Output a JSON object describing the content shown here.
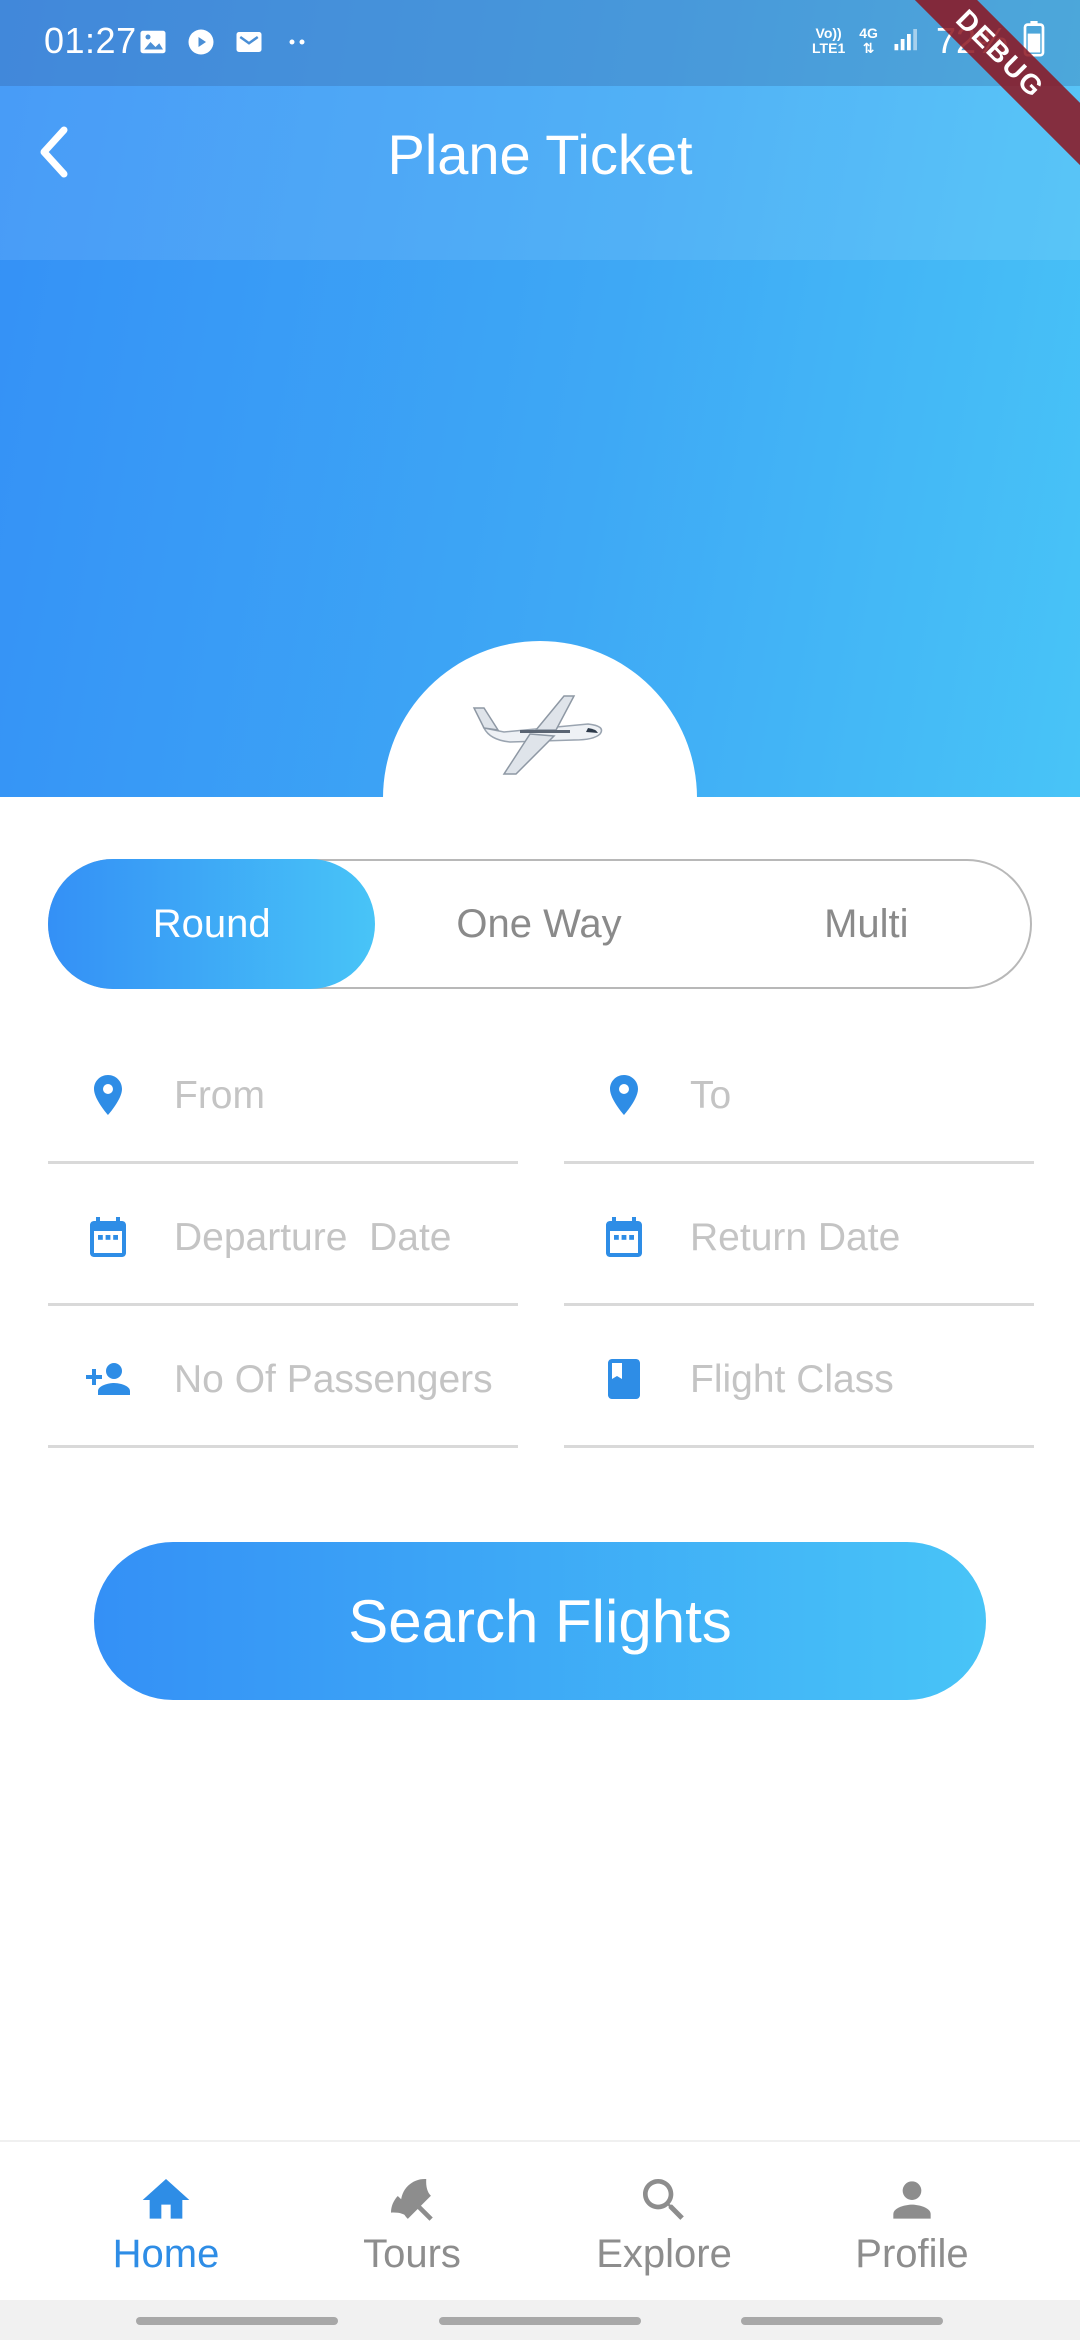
{
  "status_bar": {
    "time": "01:27",
    "network_top": "Vo))",
    "network_bottom": "LTE1",
    "net_type_top": "4G",
    "battery": "72%",
    "debug_label": "DEBUG",
    "icons": [
      "gallery-icon",
      "play-icon",
      "mail-icon",
      "more-dots-icon",
      "signal-icon",
      "battery-icon"
    ]
  },
  "header": {
    "title": "Plane Ticket",
    "back_icon": "chevron-left-icon"
  },
  "trip_types": [
    {
      "label": "Round",
      "active": true
    },
    {
      "label": "One Way",
      "active": false
    },
    {
      "label": "Multi",
      "active": false
    }
  ],
  "fields": {
    "from": {
      "placeholder": "From",
      "icon": "location-pin-icon"
    },
    "to": {
      "placeholder": "To",
      "icon": "location-pin-icon"
    },
    "departure": {
      "placeholder": "Departure  Date",
      "icon": "calendar-icon"
    },
    "return": {
      "placeholder": "Return Date",
      "icon": "calendar-icon"
    },
    "passengers": {
      "placeholder": "No Of Passengers",
      "icon": "add-person-icon"
    },
    "flight_class": {
      "placeholder": "Flight Class",
      "icon": "book-icon"
    }
  },
  "search_button": {
    "label": "Search Flights"
  },
  "bottom_nav": [
    {
      "label": "Home",
      "icon": "home-icon",
      "active": true
    },
    {
      "label": "Tours",
      "icon": "beach-umbrella-icon",
      "active": false
    },
    {
      "label": "Explore",
      "icon": "search-icon",
      "active": false
    },
    {
      "label": "Profile",
      "icon": "person-icon",
      "active": false
    }
  ],
  "colors": {
    "accent": "#2e8de6",
    "gradient_start": "#3490f6",
    "gradient_end": "#48c4f7",
    "inactive": "#8d8d8d",
    "placeholder": "#c4c4c4"
  }
}
